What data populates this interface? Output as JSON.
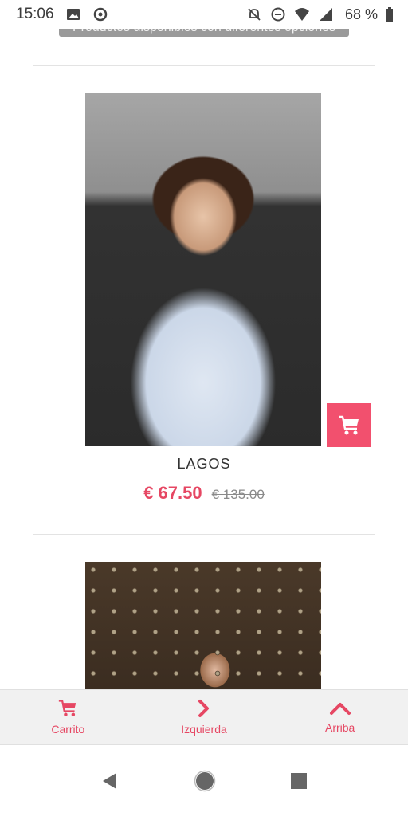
{
  "status_bar": {
    "time": "15:06",
    "battery_percent": "68 %"
  },
  "chip": {
    "text": "Productos disponibles con diferentes opciones"
  },
  "products": [
    {
      "name": "LAGOS",
      "sale_price": "€ 67.50",
      "original_price": "€ 135.00"
    }
  ],
  "bottom_nav": {
    "cart_label": "Carrito",
    "left_label": "Izquierda",
    "top_label": "Arriba"
  },
  "colors": {
    "accent": "#e64763",
    "cart_button": "#f2506e"
  },
  "icons": {
    "status": [
      "image-icon",
      "notification-icon",
      "mute-icon",
      "dnd-icon",
      "wifi-icon",
      "signal-icon",
      "battery-icon"
    ],
    "nav": [
      "cart-icon",
      "chevron-right-icon",
      "chevron-up-icon"
    ],
    "system": [
      "back-icon",
      "home-icon",
      "recents-icon"
    ]
  }
}
